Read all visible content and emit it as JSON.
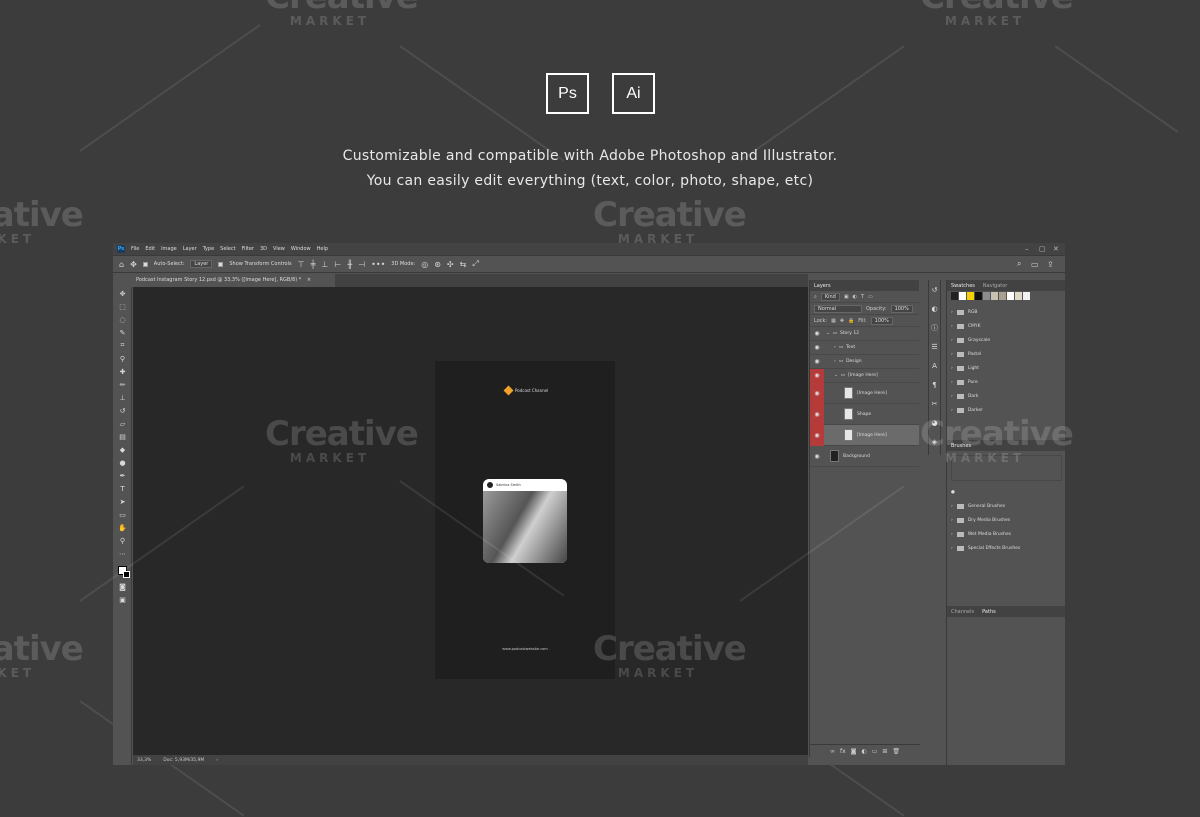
{
  "promo": {
    "badges": [
      "Ps",
      "Ai"
    ],
    "line1": "Customizable and compatible with Adobe Photoshop and Illustrator.",
    "line2": "You can easily edit everything (text, color, photo, shape, etc)"
  },
  "watermark": {
    "word": "Creative",
    "sub": "MARKET"
  },
  "menubar": {
    "logo": "Ps",
    "items": [
      "File",
      "Edit",
      "Image",
      "Layer",
      "Type",
      "Select",
      "Filter",
      "3D",
      "View",
      "Window",
      "Help"
    ]
  },
  "options": {
    "auto_select": "Auto-Select:",
    "auto_select_value": "Layer",
    "show_transform": "Show Transform Controls",
    "mode_3d": "3D Mode:"
  },
  "document": {
    "tab_title": "Podcast Instagram Story 12.psd @ 33,3% ([Image Here], RGB/8) *",
    "close": "×",
    "logo_text": "Podcast Channel",
    "post_user": "Sabrina Smith",
    "url": "www.podcastwebsite.com"
  },
  "status": {
    "zoom": "33,3%",
    "doc": "Doc: 5,93M/35,9M"
  },
  "layers_panel": {
    "tab": "Layers",
    "kind": "Kind",
    "blend": "Normal",
    "opacity_label": "Opacity:",
    "opacity": "100%",
    "lock_label": "Lock:",
    "fill_label": "Fill:",
    "fill": "100%",
    "rows": [
      {
        "name": "Story 12",
        "type": "group"
      },
      {
        "name": "Text",
        "type": "group"
      },
      {
        "name": "Design",
        "type": "group"
      },
      {
        "name": "[Image Here]",
        "type": "group"
      },
      {
        "name": "[Image Here]",
        "type": "layer"
      },
      {
        "name": "Shape",
        "type": "layer"
      },
      {
        "name": "[Image Here]",
        "type": "layer"
      },
      {
        "name": "Background",
        "type": "layer"
      }
    ],
    "bottom_icons": [
      "link-icon",
      "fx-icon",
      "mask-icon",
      "adjustment-icon",
      "folder-icon",
      "new-layer-icon",
      "trash-icon"
    ]
  },
  "swatches_panel": {
    "tabs": [
      "Swatches",
      "Navigator"
    ],
    "colors": [
      "#222222",
      "#ffffff",
      "#f5d100",
      "#111111",
      "#8c8c8c",
      "#c9c1b0",
      "#a89f8c",
      "#ffffff",
      "#e0d9c5",
      "#f2f2f2"
    ],
    "groups": [
      "RGB",
      "CMYK",
      "Grayscale",
      "Pastel",
      "Light",
      "Pure",
      "Dark",
      "Darker"
    ]
  },
  "brushes_panel": {
    "tab": "Brushes",
    "groups": [
      "General Brushes",
      "Dry Media Brushes",
      "Wet Media Brushes",
      "Special Effects Brushes"
    ]
  },
  "paths_panel": {
    "tabs": [
      "Channels",
      "Paths"
    ]
  }
}
